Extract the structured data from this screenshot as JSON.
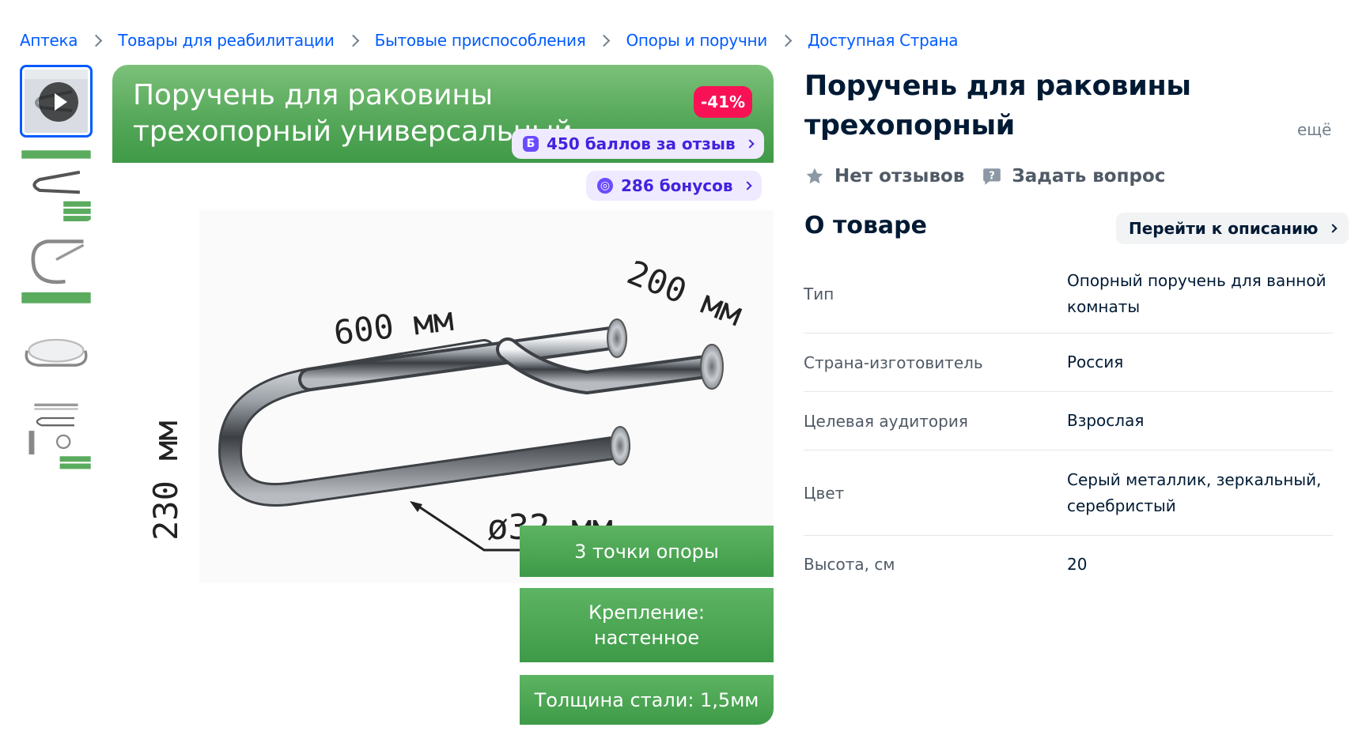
{
  "breadcrumbs": [
    "Аптека",
    "Товары для реабилитации",
    "Бытовые приспособления",
    "Опоры и поручни",
    "Доступная Страна"
  ],
  "gallery": {
    "thumbnails": [
      {
        "name": "video-thumbnail",
        "has_video": true
      },
      {
        "name": "dimensions-thumbnail"
      },
      {
        "name": "angle-view-thumbnail"
      },
      {
        "name": "sink-mounted-thumbnail"
      },
      {
        "name": "schematic-thumbnail"
      }
    ],
    "main": {
      "banner_title": "Поручень для раковины\nтрехопорный универсальный",
      "dimensions": {
        "length": "600 мм",
        "depth": "200 мм",
        "height": "230 мм",
        "diameter": "ø32 мм"
      },
      "features": [
        "3 точки опоры",
        "Крепление:\nнастенное",
        "Толщина стали: 1,5мм"
      ]
    },
    "discount_badge": "-41%",
    "review_points": "450 баллов за отзыв",
    "review_points_icon": "Б",
    "bonuses": "286 бонусов"
  },
  "product": {
    "title": "Поручень для раковины\nтрехопорный универсальный...",
    "more_label": "ещё",
    "reviews_label": "Нет отзывов",
    "ask_label": "Задать вопрос"
  },
  "about": {
    "title": "О товаре",
    "go_to_description": "Перейти к описанию",
    "specs": [
      {
        "label": "Тип",
        "value": "Опорный поручень для ванной комнаты"
      },
      {
        "label": "Страна-изготовитель",
        "value": "Россия"
      },
      {
        "label": "Целевая аудитория",
        "value": "Взрослая"
      },
      {
        "label": "Цвет",
        "value": "Серый металлик, зеркальный, серебристый"
      },
      {
        "label": "Высота, см",
        "value": "20"
      }
    ]
  },
  "colors": {
    "link": "#005bff",
    "banner_green": "#56a85a",
    "discount_red": "#f91155",
    "bonus_purple": "#4322de"
  }
}
